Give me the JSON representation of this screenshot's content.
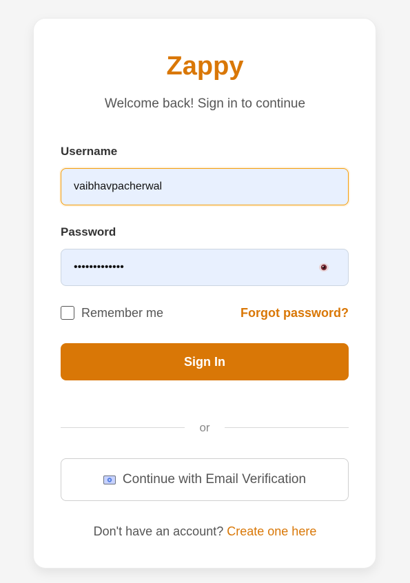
{
  "brand": {
    "name": "Zappy",
    "color": "#d97706"
  },
  "subtitle": "Welcome back! Sign in to continue",
  "username": {
    "label": "Username",
    "value": "vaibhavpacherwal"
  },
  "password": {
    "label": "Password",
    "value": "•••••••••••••",
    "toggle_icon": "eye-icon"
  },
  "remember": {
    "label": "Remember me",
    "checked": false
  },
  "forgot": {
    "label": "Forgot password?"
  },
  "signin": {
    "label": "Sign In"
  },
  "divider": {
    "label": "or"
  },
  "email_verification": {
    "label": "Continue with Email Verification",
    "icon": "email-icon"
  },
  "footer": {
    "text": "Don't have an account?",
    "link": "Create one here"
  },
  "colors": {
    "accent": "#d97706",
    "input_bg": "#e8f0fe",
    "page_bg": "#f5f5f5"
  }
}
